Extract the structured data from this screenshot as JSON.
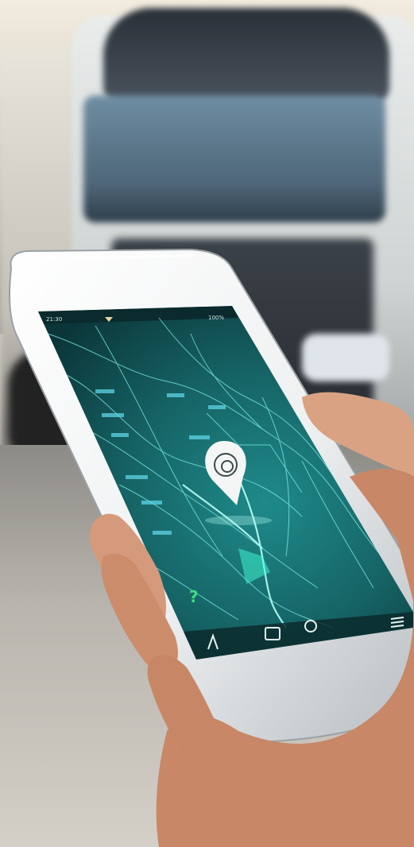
{
  "statusbar": {
    "left_text": "21:30",
    "right_text": "100%"
  },
  "map": {
    "pin_icon": "location-pin-icon",
    "labels": [
      "",
      "",
      "",
      ""
    ]
  },
  "navbar": {
    "items": [
      "navigate-icon",
      "map-icon",
      "home-icon",
      "menu-icon"
    ]
  },
  "colors": {
    "screen_dark": "#0c3a3e",
    "screen_mid": "#145a5e",
    "route_cyan": "#7ff0e8",
    "help_green": "#3be07d"
  }
}
